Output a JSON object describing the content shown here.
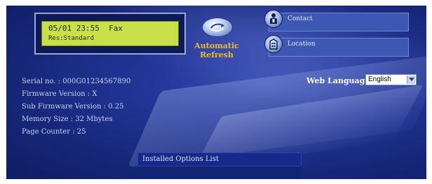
{
  "lcd": {
    "line1": "05/01 23:55  Fax",
    "line2": "Res:Standard"
  },
  "refresh": {
    "label": "Automatic\nRefresh",
    "icon": "refresh-icon"
  },
  "links": [
    {
      "label": "Contact",
      "icon": "contact-person-icon"
    },
    {
      "label": "Location",
      "icon": "location-building-icon"
    }
  ],
  "device_info": {
    "serial": "Serial no. : 000G01234567890",
    "firmware": "Firmware Version : X",
    "sub_firmware": "Sub Firmware Version : 0.25",
    "memory": "Memory Size : 32 Mbytes",
    "page_counter": "Page Counter : 25"
  },
  "language": {
    "label": "Web Language:",
    "selected": "English"
  },
  "options": {
    "header": "Installed Options List"
  },
  "colors": {
    "background": "#1b2c85",
    "lcd": "#c8e04a",
    "refresh_text": "#f2b92d",
    "link_bar": "#3d58b3"
  }
}
